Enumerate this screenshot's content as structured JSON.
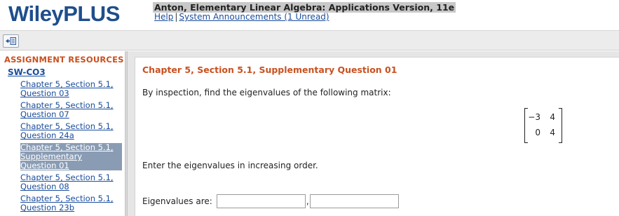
{
  "header": {
    "logo": "WileyPLUS",
    "course_title": "Anton, Elementary Linear Algebra: Applications Version, 11e",
    "help_link": "Help",
    "separator": "|",
    "announcements_link": "System Announcements (1 Unread)"
  },
  "toolbar": {
    "collapse_icon": "collapse-sidebar-icon"
  },
  "sidebar": {
    "heading": "ASSIGNMENT RESOURCES",
    "group": "SW-CO3",
    "items": [
      {
        "line1": "Chapter 5, Section 5.1,",
        "line2": "Question 03",
        "selected": false
      },
      {
        "line1": "Chapter 5, Section 5.1,",
        "line2": "Question 07",
        "selected": false
      },
      {
        "line1": "Chapter 5, Section 5.1,",
        "line2": "Question 24a",
        "selected": false
      },
      {
        "line1": "Chapter 5, Section 5.1,",
        "line2": "Supplementary",
        "line3": "Question 01",
        "selected": true
      },
      {
        "line1": "Chapter 5, Section 5.1,",
        "line2": "Question 08",
        "selected": false
      },
      {
        "line1": "Chapter 5, Section 5.1,",
        "line2": "Question 23b",
        "selected": false
      }
    ]
  },
  "main": {
    "title": "Chapter 5, Section 5.1, Supplementary Question 01",
    "prompt": "By inspection, find the eigenvalues of the following matrix:",
    "matrix": {
      "r1c1": "−3",
      "r1c2": "4",
      "r2c1": "0",
      "r2c2": "4"
    },
    "instruction": "Enter the eigenvalues in increasing order.",
    "answer_label": "Eigenvalues are:",
    "answer_separator": ",",
    "answer_values": [
      "",
      ""
    ]
  },
  "colors": {
    "brand": "#1f4e8c",
    "accent": "#c9501f",
    "link": "#1a4d9c",
    "selected_bg": "#8a9cb4"
  }
}
